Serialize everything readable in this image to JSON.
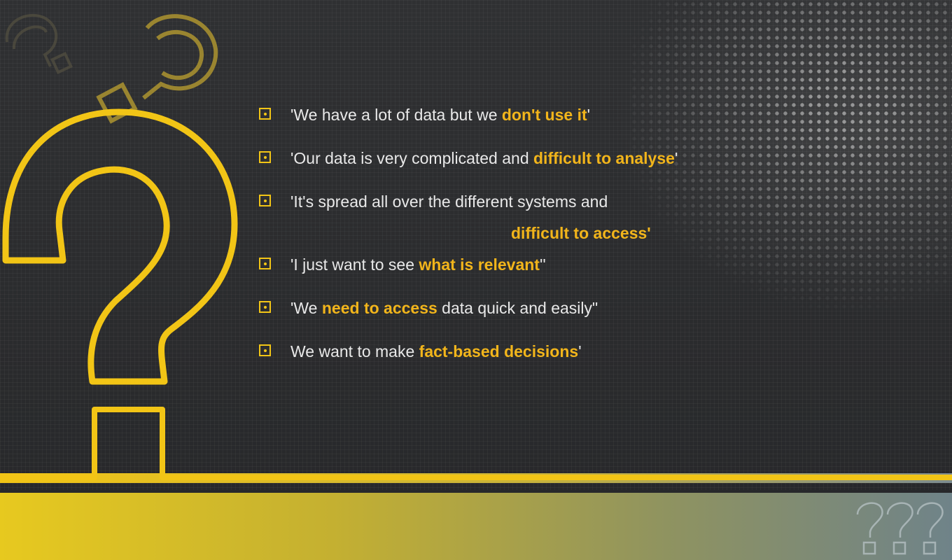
{
  "bullets": [
    {
      "pre": "'We have a lot of data but we ",
      "hl": "don't use it",
      "post": "'"
    },
    {
      "pre": "'Our data is very complicated and ",
      "hl": "difficult to analyse",
      "post": "'"
    },
    {
      "pre": "'It's spread all over the different systems and",
      "hl": "difficult to access'",
      "post": ""
    },
    {
      "pre": "'I just want to see ",
      "hl": "what is relevant",
      "post": "''"
    },
    {
      "pre": "'We ",
      "hl": "need to access",
      "post": " data quick and easily\""
    },
    {
      "pre": "We want to make ",
      "hl": "fact-based decisions",
      "post": "'"
    }
  ],
  "colors": {
    "accent": "#f2c516",
    "highlight_text": "#f2b51b",
    "body_text": "#e9e9e9",
    "background": "#2b2c2e",
    "footer_start": "#e7c91f",
    "footer_end": "#6f8389"
  },
  "icons": [
    "large-question-mark-icon",
    "small-question-mark-icon",
    "faint-question-mark-icon",
    "triple-question-mark-icon",
    "checkbox-bullet-icon"
  ]
}
